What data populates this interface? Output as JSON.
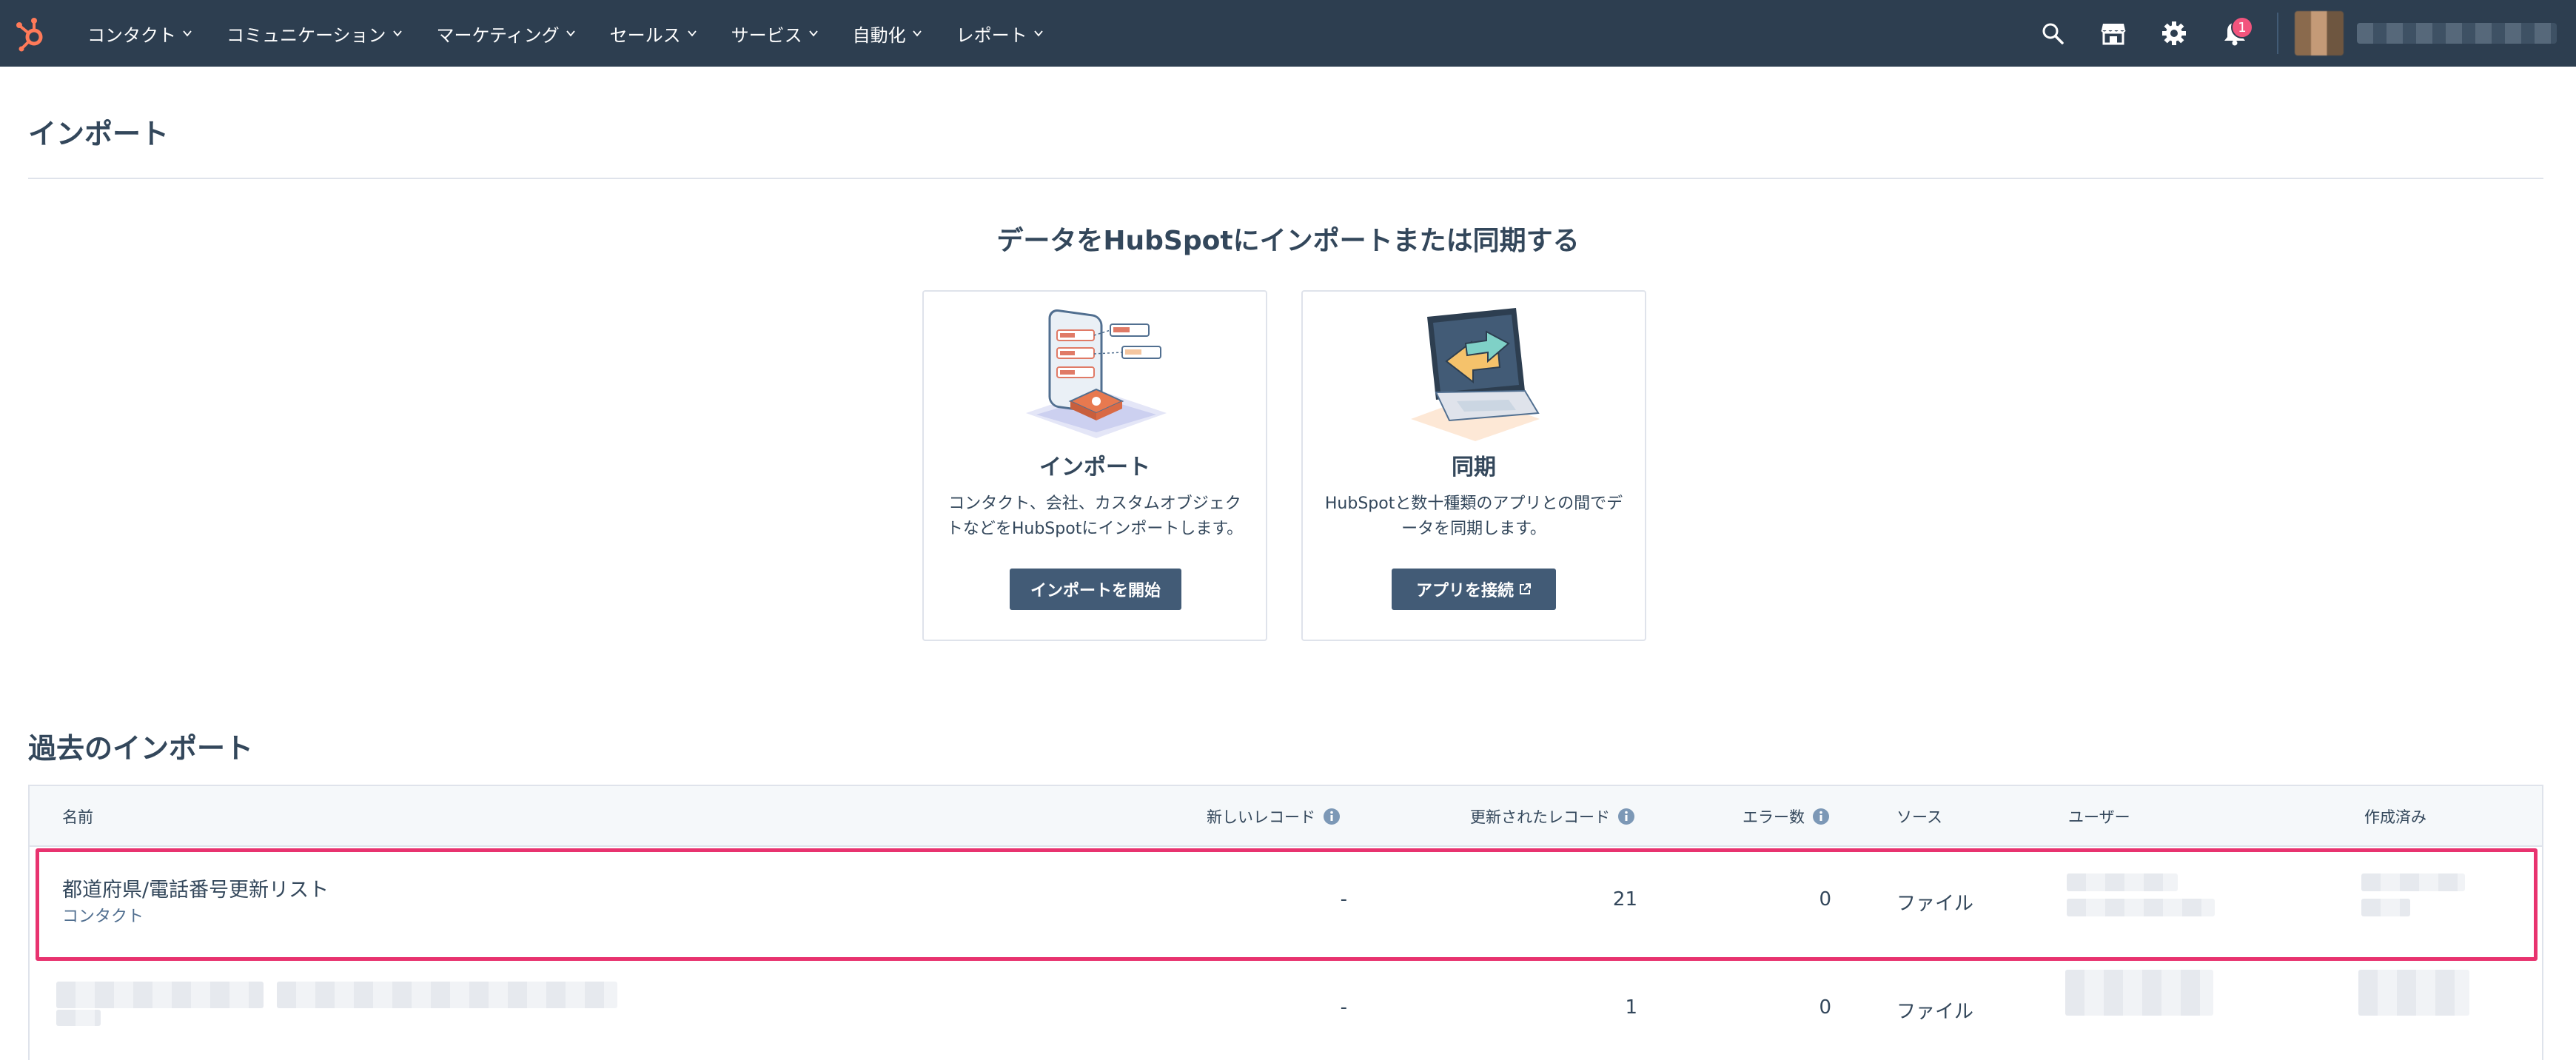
{
  "nav": {
    "items": [
      {
        "label": "コンタクト"
      },
      {
        "label": "コミュニケーション"
      },
      {
        "label": "マーケティング"
      },
      {
        "label": "セールス"
      },
      {
        "label": "サービス"
      },
      {
        "label": "自動化"
      },
      {
        "label": "レポート"
      }
    ],
    "notification_count": "1",
    "icons": [
      "search-icon",
      "marketplace-icon",
      "settings-icon",
      "notifications-icon"
    ],
    "accent": "#ff7a59"
  },
  "page": {
    "title": "インポート",
    "hero_title": "データをHubSpotにインポートまたは同期する"
  },
  "cards": {
    "import": {
      "title": "インポート",
      "description": "コンタクト、会社、カスタムオブジェクトなどをHubSpotにインポートします。",
      "button": "インポートを開始"
    },
    "sync": {
      "title": "同期",
      "description": "HubSpotと数十種類のアプリとの間でデータを同期します。",
      "button": "アプリを接続"
    }
  },
  "past_imports": {
    "title": "過去のインポート",
    "columns": {
      "name": "名前",
      "new_records": "新しいレコード",
      "updated_records": "更新されたレコード",
      "errors": "エラー数",
      "source": "ソース",
      "user": "ユーザー",
      "created": "作成済み"
    },
    "rows": [
      {
        "name": "都道府県/電話番号更新リスト",
        "object": "コンタクト",
        "new": "-",
        "updated": "21",
        "errors": "0",
        "source": "ファイル"
      },
      {
        "name": "",
        "object": "",
        "new": "-",
        "updated": "1",
        "errors": "0",
        "source": "ファイル"
      }
    ]
  }
}
